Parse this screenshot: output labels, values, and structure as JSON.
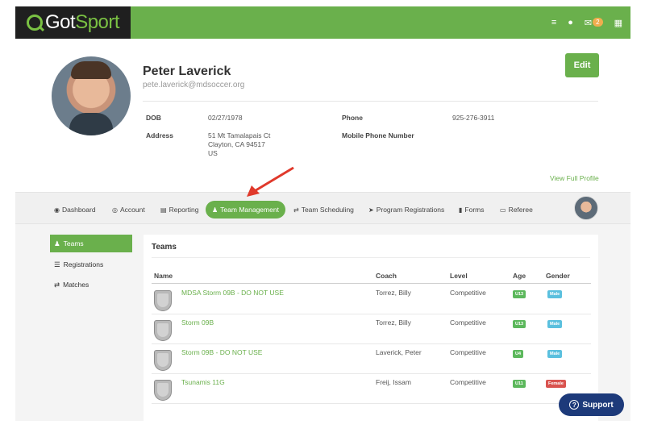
{
  "brand": {
    "logo_prefix": "Got",
    "logo_suffix": "Sport",
    "accent": "#6ab04c",
    "dark": "#1f1f1f"
  },
  "topbar": {
    "icons": [
      "list-icon",
      "user-icon",
      "mail-icon",
      "grid-icon"
    ],
    "mail_count": "2"
  },
  "profile": {
    "name": "Peter Laverick",
    "email": "pete.laverick@mdsoccer.org",
    "edit_label": "Edit",
    "dob_label": "DOB",
    "dob": "02/27/1978",
    "address_label": "Address",
    "address_line1": "51 Mt Tamalapais Ct",
    "address_line2": "Clayton, CA 94517",
    "address_line3": "US",
    "phone_label": "Phone",
    "phone": "925-276-3911",
    "mobile_label": "Mobile Phone Number",
    "view_full": "View Full Profile"
  },
  "nav": {
    "items": [
      {
        "label": "Dashboard",
        "icon": "dashboard-icon"
      },
      {
        "label": "Account",
        "icon": "account-icon"
      },
      {
        "label": "Reporting",
        "icon": "reporting-icon"
      },
      {
        "label": "Team Management",
        "icon": "team-icon"
      },
      {
        "label": "Team Scheduling",
        "icon": "swap-icon"
      },
      {
        "label": "Program Registrations",
        "icon": "send-icon"
      },
      {
        "label": "Forms",
        "icon": "file-icon"
      },
      {
        "label": "Referee",
        "icon": "calendar-icon"
      }
    ],
    "active": "Team Management"
  },
  "sidebar": {
    "items": [
      {
        "label": "Teams",
        "icon": "team-icon"
      },
      {
        "label": "Registrations",
        "icon": "list-icon"
      },
      {
        "label": "Matches",
        "icon": "swap-icon"
      }
    ]
  },
  "teams": {
    "title": "Teams",
    "headers": {
      "name": "Name",
      "coach": "Coach",
      "level": "Level",
      "age": "Age",
      "gender": "Gender"
    },
    "rows": [
      {
        "name": "MDSA Storm 09B - DO NOT USE",
        "coach": "Torrez, Billy",
        "level": "Competitive",
        "age": "U13",
        "gender": "Male"
      },
      {
        "name": "Storm 09B",
        "coach": "Torrez, Billy",
        "level": "Competitive",
        "age": "U13",
        "gender": "Male"
      },
      {
        "name": "Storm 09B - DO NOT USE",
        "coach": "Laverick, Peter",
        "level": "Competitive",
        "age": "U4",
        "gender": "Male"
      },
      {
        "name": "Tsunamis 11G",
        "coach": "Freij, Issam",
        "level": "Competitive",
        "age": "U11",
        "gender": "Female"
      }
    ]
  },
  "support": {
    "label": "Support"
  }
}
